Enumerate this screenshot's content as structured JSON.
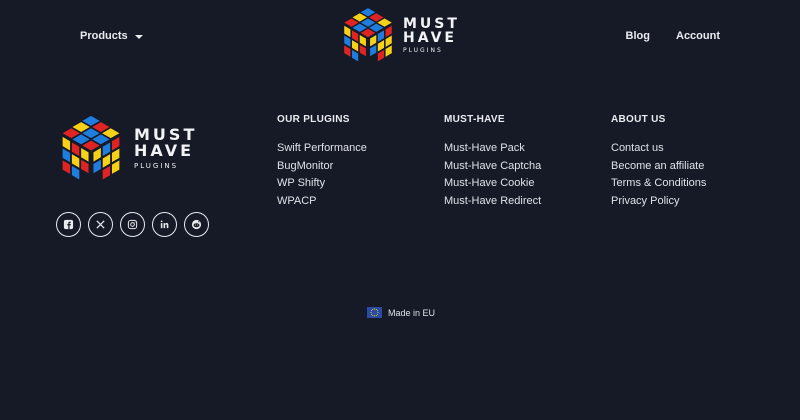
{
  "header": {
    "products_label": "Products",
    "blog_label": "Blog",
    "account_label": "Account"
  },
  "logo": {
    "line1": "MUST",
    "line2": "HAVE",
    "line3": "PLUGINS",
    "colors": [
      "#f7d117",
      "#e02424",
      "#1f7de0",
      "#f7d117"
    ]
  },
  "social": [
    {
      "icon": "facebook-icon"
    },
    {
      "icon": "x-icon"
    },
    {
      "icon": "instagram-icon"
    },
    {
      "icon": "linkedin-icon"
    },
    {
      "icon": "reddit-icon"
    }
  ],
  "footer": {
    "columns": [
      {
        "title": "OUR PLUGINS",
        "links": [
          "Swift Performance",
          "BugMonitor",
          "WP Shifty",
          "WPACP"
        ]
      },
      {
        "title": "MUST-HAVE",
        "links": [
          "Must-Have Pack",
          "Must-Have Captcha",
          "Must-Have Cookie",
          "Must-Have Redirect"
        ]
      },
      {
        "title": "ABOUT US",
        "links": [
          "Contact us",
          "Become an affiliate",
          "Terms & Conditions",
          "Privacy Policy"
        ]
      }
    ],
    "made_in": "Made in EU"
  }
}
